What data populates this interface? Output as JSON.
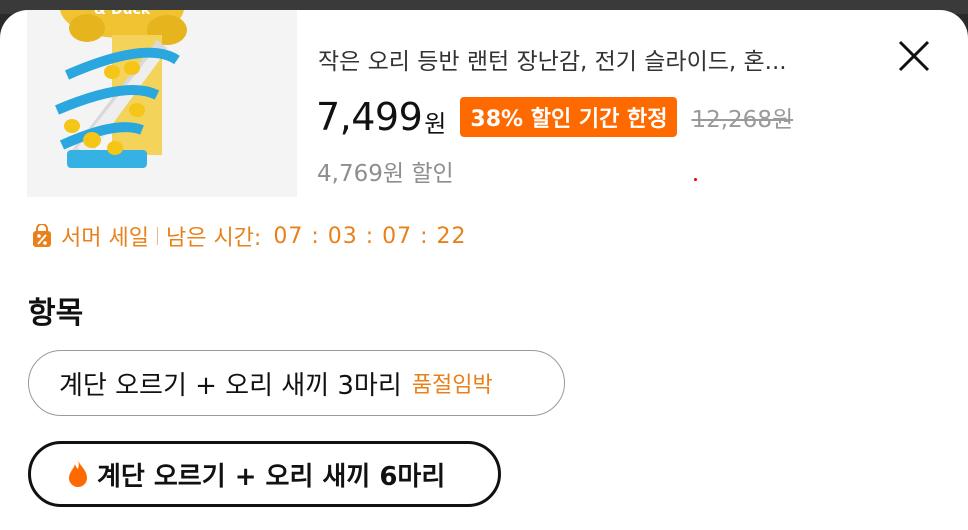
{
  "product": {
    "title": "작은 오리 등반 랜턴 장난감, 전기 슬라이드, 혼...",
    "price": "7,499",
    "price_unit": "원",
    "promo_badge": "38% 할인 기간 한정",
    "original_price": "12,268원",
    "savings": "4,769원 할인",
    "image_caption": "& Duck"
  },
  "sale": {
    "label": "서머 세일",
    "remaining_label": "남은 시간:",
    "countdown": "07 : 03 : 07 : 22"
  },
  "options": {
    "title": "항목",
    "items": [
      {
        "label": "계단 오르기 + 오리 새끼 3마리",
        "tag": "품절임박"
      },
      {
        "label": "계단 오르기 + 오리 새끼 6마리",
        "tag": ""
      }
    ]
  },
  "colors": {
    "accent": "#ff6a00",
    "sale_text": "#e8811c",
    "strike_gray": "#9a9a9a"
  },
  "icons": {
    "close": "close-icon",
    "sale": "shopping-bag-percent-icon",
    "hot": "flame-icon"
  }
}
